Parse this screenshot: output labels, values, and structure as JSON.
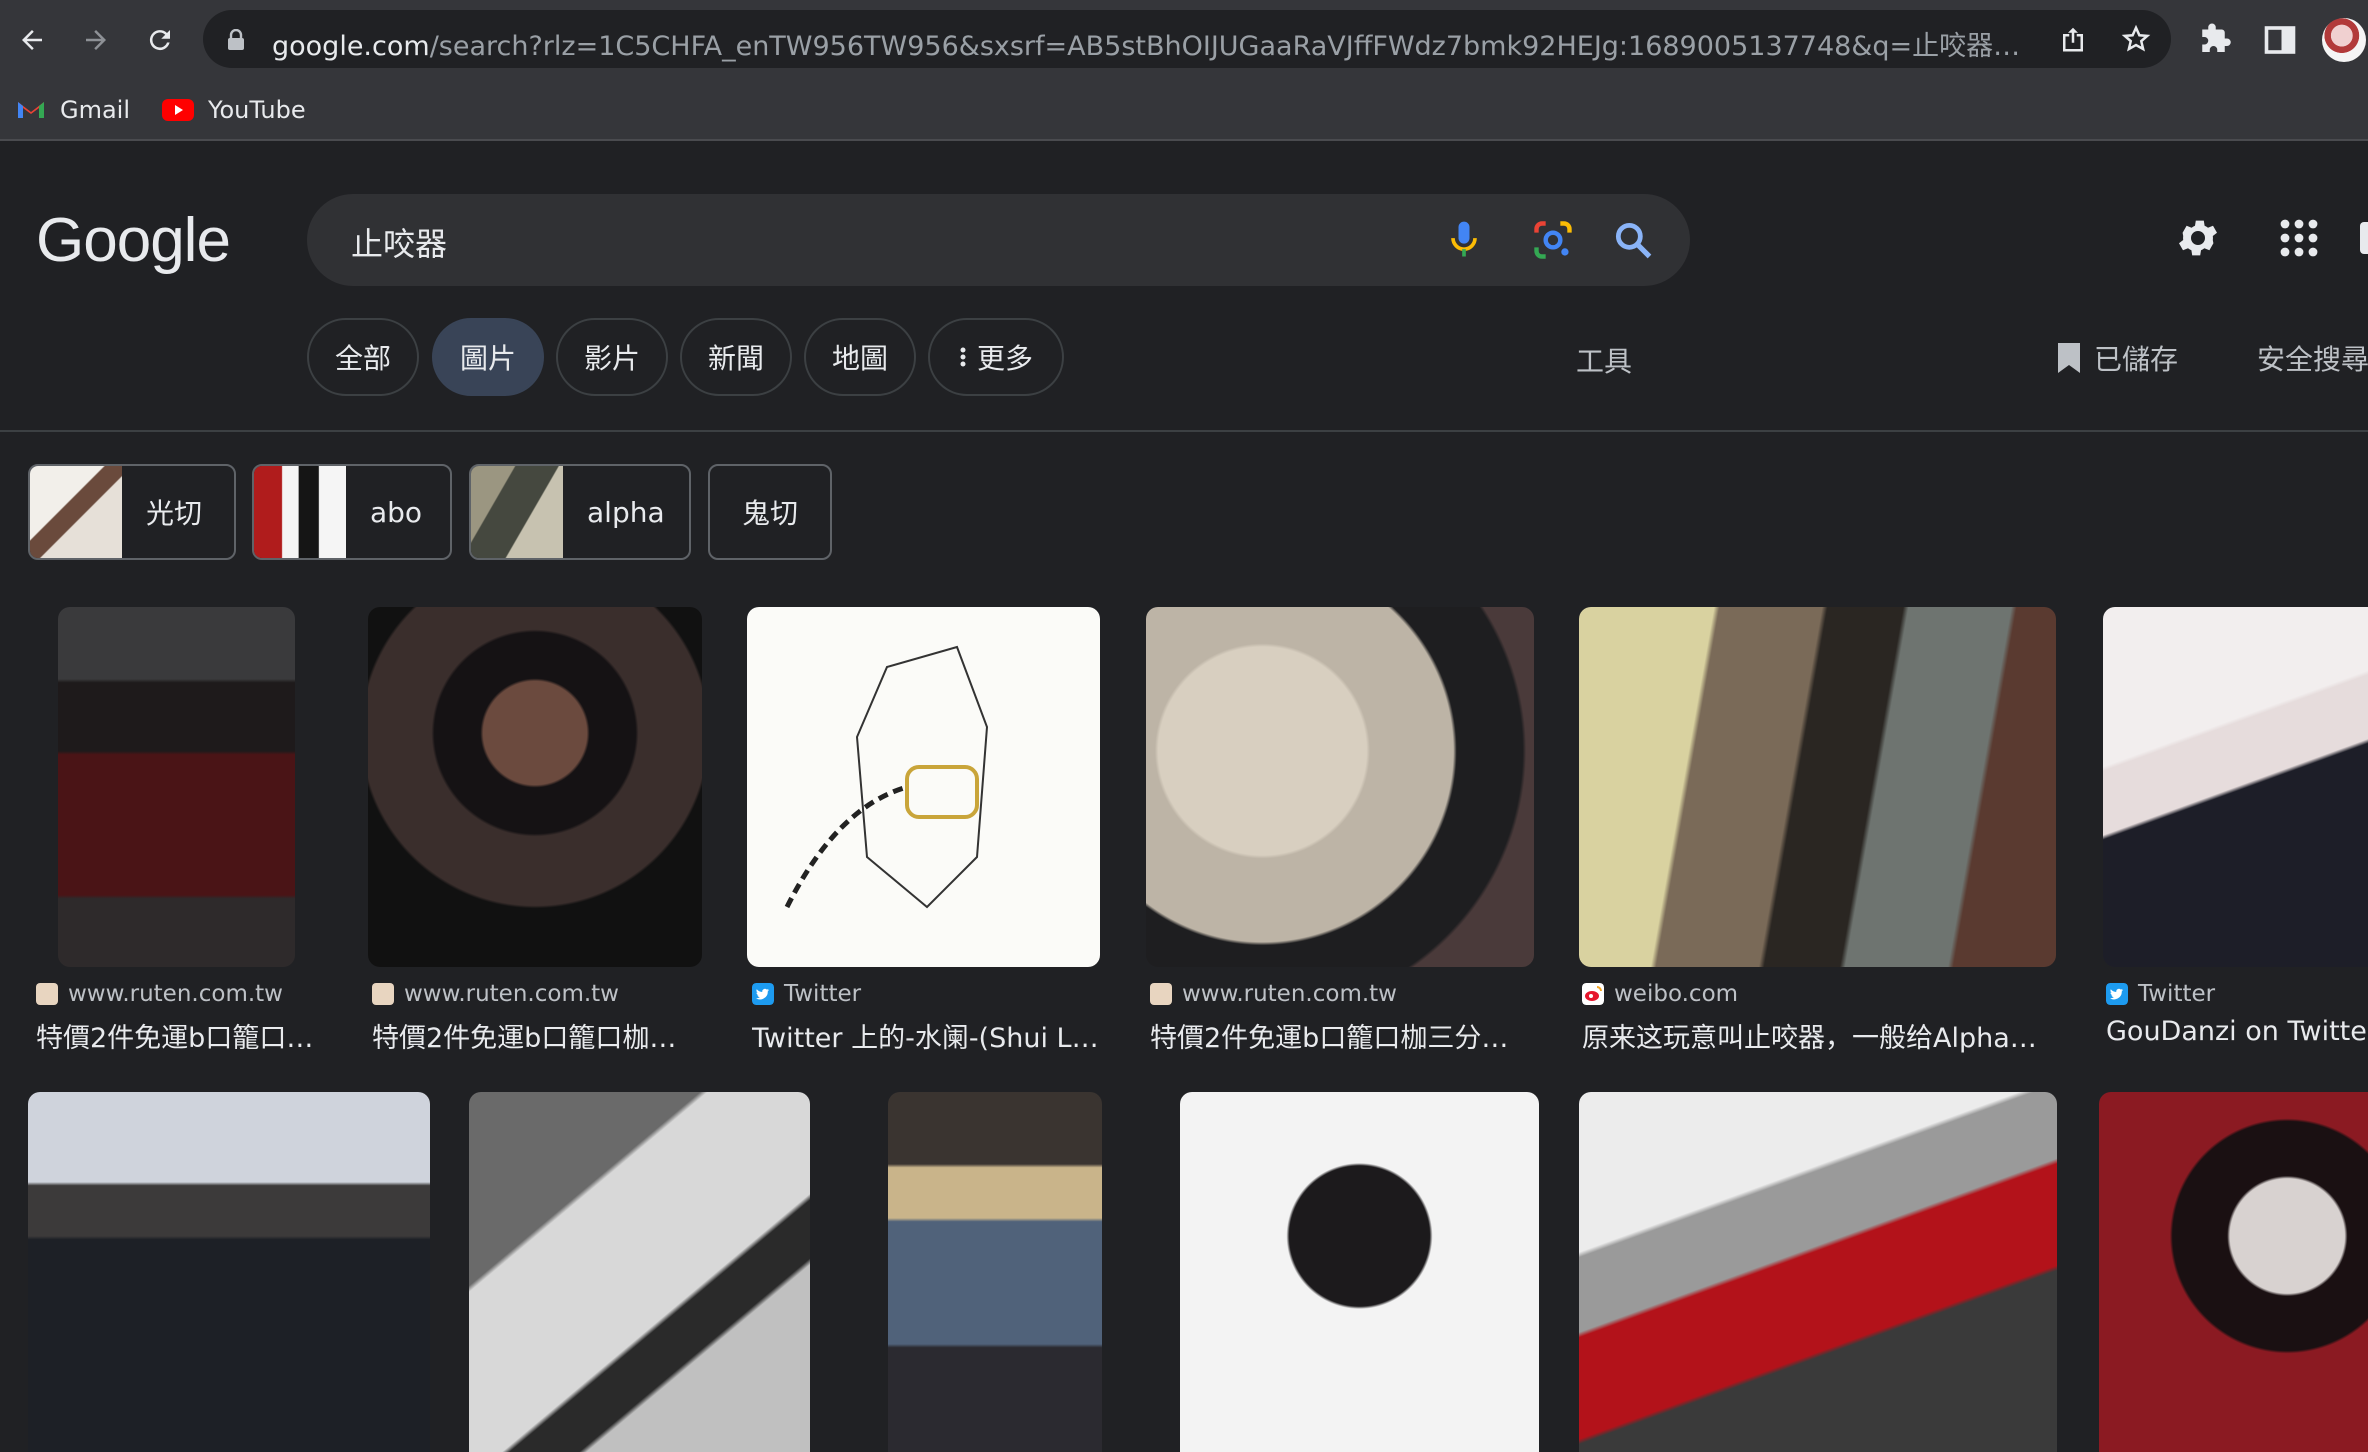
{
  "browser": {
    "url_host": "google.com",
    "url_rest": "/search?rlz=1C5CHFA_enTW956TW956&sxsrf=AB5stBhOIJUGaaRaVJffFWdz7bmk92HEJg:1689005137748&q=止咬器&...",
    "bookmarks": [
      {
        "label": "Gmail"
      },
      {
        "label": "YouTube"
      }
    ]
  },
  "search": {
    "logo": "Google",
    "query": "止咬器"
  },
  "tabs": [
    {
      "label": "全部"
    },
    {
      "label": "圖片"
    },
    {
      "label": "影片"
    },
    {
      "label": "新聞"
    },
    {
      "label": "地圖"
    },
    {
      "label": "更多"
    }
  ],
  "toolbar": {
    "tools": "工具",
    "saved": "已儲存",
    "safe_search": "安全搜尋"
  },
  "chips": [
    {
      "label": "光切"
    },
    {
      "label": "abo"
    },
    {
      "label": "alpha"
    },
    {
      "label": "鬼切"
    }
  ],
  "results_row1": [
    {
      "source": "www.ruten.com.tw",
      "title": "特價2件免運b口籠口…"
    },
    {
      "source": "www.ruten.com.tw",
      "title": "特價2件免運b口籠口枷…"
    },
    {
      "source": "Twitter",
      "title": "Twitter 上的-水阑-(Shui L…"
    },
    {
      "source": "www.ruten.com.tw",
      "title": "特價2件免運b口籠口枷三分…"
    },
    {
      "source": "weibo.com",
      "title": "原来这玩意叫止咬器，一般给Alpha…"
    },
    {
      "source": "Twitter",
      "title": "GouDanzi on Twitter"
    }
  ],
  "colors": {
    "background": "#202124",
    "chrome": "#35363a",
    "active_tab": "#394457"
  }
}
